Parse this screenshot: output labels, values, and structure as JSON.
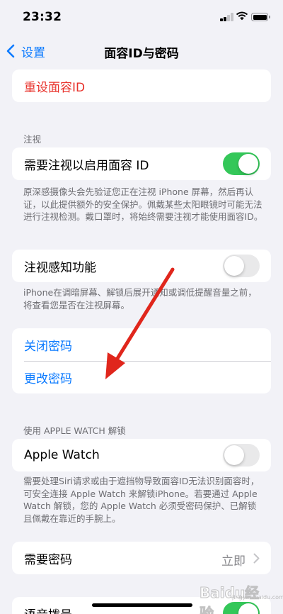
{
  "status_bar": {
    "time": "23:32"
  },
  "nav": {
    "back_label": "设置",
    "title": "面容ID与密码"
  },
  "reset_face_id": {
    "label": "重设面容ID"
  },
  "attention": {
    "header": "注视",
    "require_attention": {
      "label": "需要注视以启用面容 ID",
      "enabled": true
    },
    "footnote": "原深感摄像头会先验证您正在注视 iPhone 屏幕，然后再认证，以此提供额外的安全保护。佩戴某些太阳眼镜时可能无法进行注视检测。戴口罩时，将始终需要注视才能使用面容ID。"
  },
  "attention_aware": {
    "label": "注视感知功能",
    "enabled": false,
    "footnote": "iPhone在调暗屏幕、解锁后展开通知或调低提醒音量之前，将查看您是否在注视屏幕。"
  },
  "passcode": {
    "turn_off": "关闭密码",
    "change": "更改密码"
  },
  "apple_watch": {
    "header": "使用 APPLE WATCH 解锁",
    "label": "Apple Watch",
    "enabled": false,
    "footnote": "需要处理Siri请求或由于遮挡物导致面容ID无法识别面容时，可安全连接 Apple Watch 来解锁iPhone。若要通过 Apple Watch 解锁，您的 Apple Watch 必须受密码保护、已解锁且佩戴在靠近的手腕上。"
  },
  "require_passcode": {
    "label": "需要密码",
    "value": "立即"
  },
  "voice_dial": {
    "label": "语音拨号",
    "enabled": true
  },
  "watermark": {
    "brand": "Baidu",
    "cn": "经验",
    "sub": "jingyan.baidu.com"
  },
  "colors": {
    "accent": "#0a7aff",
    "destructive": "#e8322b",
    "toggle_on": "#34c759",
    "annotation_arrow": "#e0261c"
  }
}
